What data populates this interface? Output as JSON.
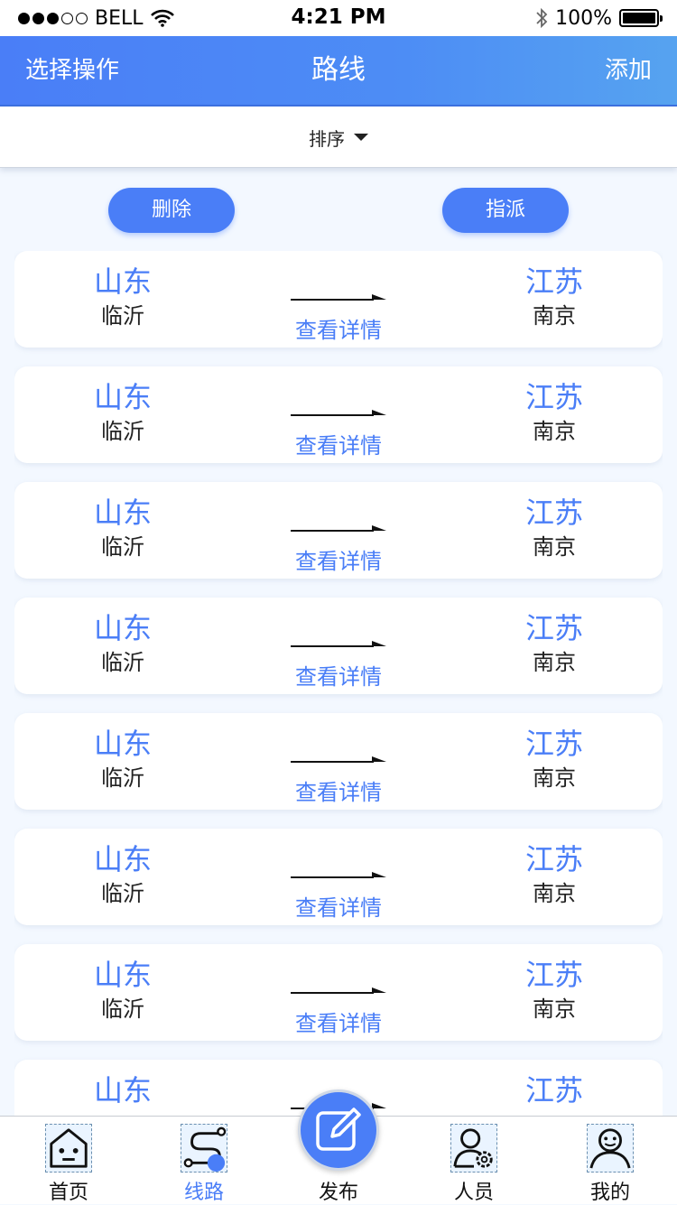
{
  "status_bar": {
    "carrier": "BELL",
    "time": "4:21 PM",
    "battery": "100%",
    "icons": [
      "signal-dots-icon",
      "wifi-icon",
      "bluetooth-icon",
      "battery-icon"
    ]
  },
  "nav": {
    "left": "选择操作",
    "title": "路线",
    "right": "添加"
  },
  "sort": {
    "label": "排序",
    "icon": "caret-down-icon"
  },
  "actions": {
    "delete": "删除",
    "assign": "指派"
  },
  "routes": [
    {
      "from_province": "山东",
      "from_city": "临沂",
      "to_province": "江苏",
      "to_city": "南京",
      "detail": "查看详情"
    },
    {
      "from_province": "山东",
      "from_city": "临沂",
      "to_province": "江苏",
      "to_city": "南京",
      "detail": "查看详情"
    },
    {
      "from_province": "山东",
      "from_city": "临沂",
      "to_province": "江苏",
      "to_city": "南京",
      "detail": "查看详情"
    },
    {
      "from_province": "山东",
      "from_city": "临沂",
      "to_province": "江苏",
      "to_city": "南京",
      "detail": "查看详情"
    },
    {
      "from_province": "山东",
      "from_city": "临沂",
      "to_province": "江苏",
      "to_city": "南京",
      "detail": "查看详情"
    },
    {
      "from_province": "山东",
      "from_city": "临沂",
      "to_province": "江苏",
      "to_city": "南京",
      "detail": "查看详情"
    },
    {
      "from_province": "山东",
      "from_city": "临沂",
      "to_province": "江苏",
      "to_city": "南京",
      "detail": "查看详情"
    },
    {
      "from_province": "山东",
      "from_city": "",
      "to_province": "江苏",
      "to_city": "",
      "detail": ""
    }
  ],
  "tabs": {
    "home": "首页",
    "routes": "线路",
    "publish": "发布",
    "people": "人员",
    "mine": "我的"
  },
  "colors": {
    "accent": "#4a7ef7",
    "background": "#f3f8ff"
  }
}
